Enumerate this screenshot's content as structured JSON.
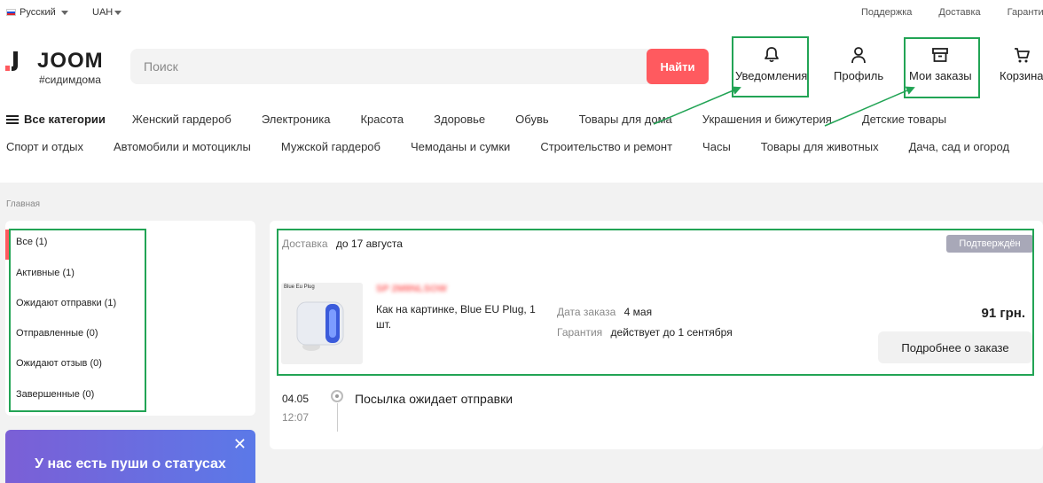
{
  "topbar": {
    "language": "Русский",
    "currency": "UAH",
    "links": [
      "Поддержка",
      "Доставка",
      "Гарантия"
    ]
  },
  "header": {
    "logo_text": "JOOM",
    "logo_tagline": "#сидимдома",
    "search_placeholder": "Поиск",
    "search_button": "Найти",
    "notifications_label": "Уведомления",
    "profile_label": "Профиль",
    "orders_label": "Мои заказы",
    "cart_label": "Корзина"
  },
  "categories": {
    "all_label": "Все категории",
    "row1": [
      "Женский гардероб",
      "Электроника",
      "Красота",
      "Здоровье",
      "Обувь",
      "Товары для дома",
      "Украшения и бижутерия",
      "Детские товары"
    ],
    "row2": [
      "Спорт и отдых",
      "Автомобили и мотоциклы",
      "Мужской гардероб",
      "Чемоданы и сумки",
      "Строительство и ремонт",
      "Часы",
      "Товары для животных",
      "Дача, сад и огород"
    ]
  },
  "breadcrumb": "Главная",
  "filters": [
    "Все (1)",
    "Активные (1)",
    "Ожидают отправки (1)",
    "Отправленные (0)",
    "Ожидают отзыв (0)",
    "Завершенные (0)"
  ],
  "promo": {
    "title": "У нас есть пуши о статусах"
  },
  "order": {
    "delivery_label": "Доставка",
    "delivery_value": "до 17 августа",
    "status_badge": "Подтверждён",
    "thumb_label": "Blue Eu Plug",
    "order_code": "SP 2M8NLSOW",
    "product_name": "Как на картинке, Blue EU Plug, 1 шт.",
    "order_date_label": "Дата заказа",
    "order_date_value": "4 мая",
    "warranty_label": "Гарантия",
    "warranty_value": "действует до 1 сентября",
    "price": "91 грн.",
    "details_button": "Подробнее о заказе"
  },
  "timeline": {
    "date": "04.05",
    "time": "12:07",
    "event": "Посылка ожидает отправки"
  },
  "colors": {
    "accent_red": "#ff5a5f",
    "highlight_green": "#22a455",
    "promo_gradient_start": "#7b5fd6",
    "promo_gradient_end": "#5b79e8",
    "badge_gray": "#a8a8b8"
  }
}
